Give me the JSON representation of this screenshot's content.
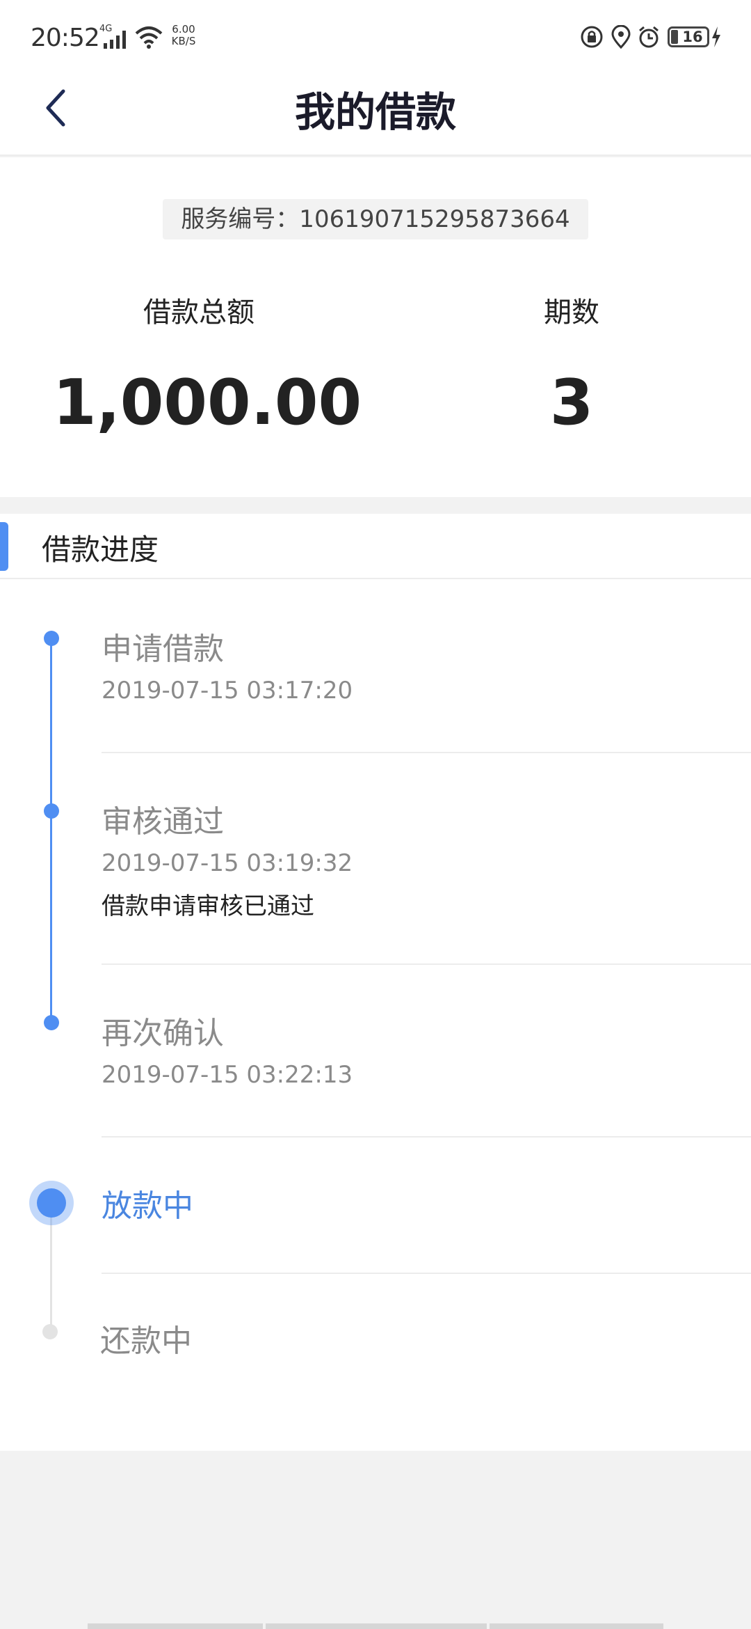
{
  "status_bar": {
    "time": "20:52",
    "network": "4G",
    "speed_value": "6.00",
    "speed_unit": "KB/S",
    "battery": "16"
  },
  "header": {
    "title": "我的借款"
  },
  "summary": {
    "service_number": "服务编号：106190715295873664",
    "total_label": "借款总额",
    "total_value": "1,000.00",
    "periods_label": "期数",
    "periods_value": "3"
  },
  "progress": {
    "title": "借款进度",
    "steps": [
      {
        "title": "申请借款",
        "time": "2019-07-15 03:17:20",
        "note": ""
      },
      {
        "title": "审核通过",
        "time": "2019-07-15 03:19:32",
        "note": "借款申请审核已通过"
      },
      {
        "title": "再次确认",
        "time": "2019-07-15 03:22:13",
        "note": ""
      },
      {
        "title": "放款中",
        "time": "",
        "note": ""
      },
      {
        "title": "还款中",
        "time": "",
        "note": ""
      }
    ]
  },
  "colors": {
    "accent": "#4f8ef2",
    "pending": "#e3e3e3",
    "background": "#f2f2f2"
  }
}
